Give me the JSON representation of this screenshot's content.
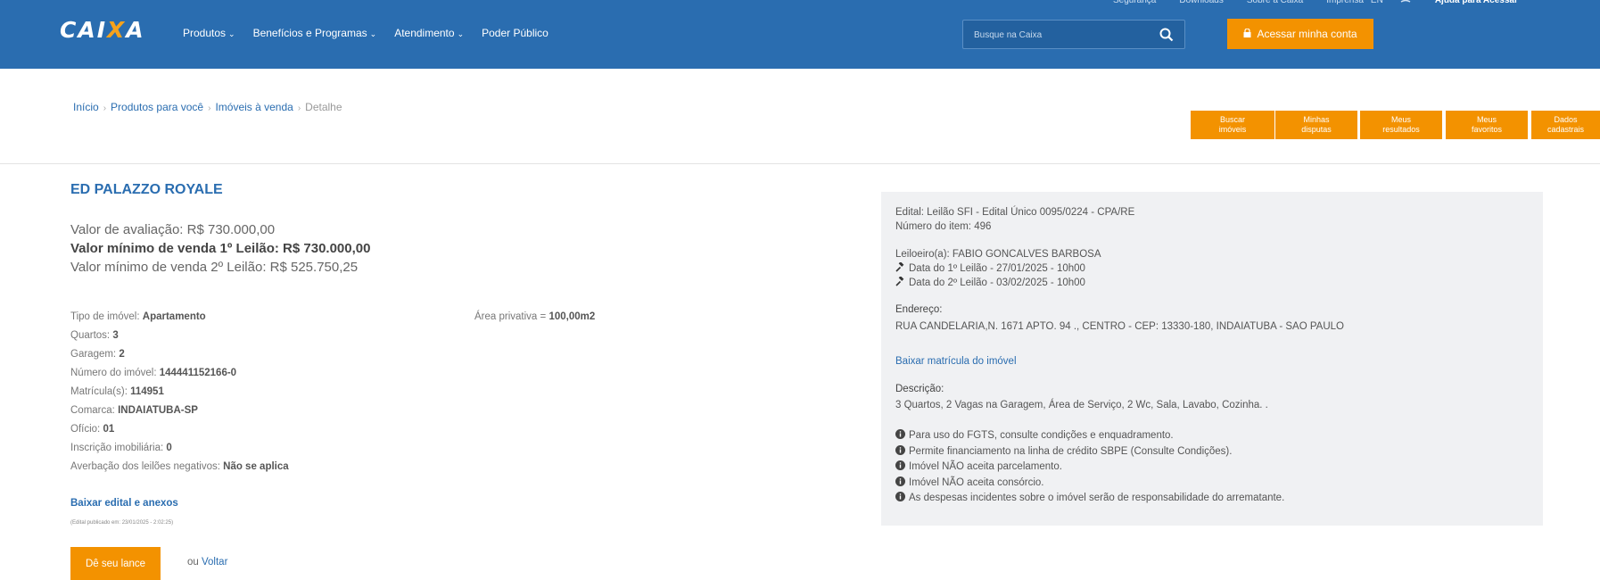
{
  "header": {
    "logo_text_a": "CAI",
    "logo_text_x": "X",
    "logo_text_b": "A",
    "nav": [
      "Produtos",
      "Benefícios e Programas",
      "Atendimento",
      "Poder Público"
    ],
    "utility": [
      "Segurança",
      "Downloads",
      "Sobre a Caixa",
      "Imprensa",
      "EN"
    ],
    "utility_help": "Ajuda para Acessar",
    "search_placeholder": "Busque na Caixa",
    "access_label": "Acessar minha conta",
    "colors": {
      "bar": "#2a6db0",
      "accent": "#f39200"
    }
  },
  "breadcrumb": {
    "home": "Início",
    "products": "Produtos para você",
    "properties": "Imóveis à venda",
    "current": "Detalhe"
  },
  "quick_buttons": [
    {
      "line1": "Buscar",
      "line2": "imóveis"
    },
    {
      "line1": "Minhas",
      "line2": "disputas"
    },
    {
      "line1": "Meus",
      "line2": "resultados"
    },
    {
      "line1": "Meus",
      "line2": "favoritos"
    },
    {
      "line1": "Dados",
      "line2": "cadastrais"
    }
  ],
  "property": {
    "title": "ED PALAZZO ROYALE",
    "valuation": "Valor de avaliação: R$ 730.000,00",
    "min_price_1": "Valor mínimo de venda 1º Leilão: R$ 730.000,00",
    "min_price_2": "Valor mínimo de venda 2º Leilão: R$ 525.750,25",
    "details": [
      {
        "label": "Tipo de imóvel:",
        "value": "Apartamento"
      },
      {
        "label": "Quartos:",
        "value": "3"
      },
      {
        "label": "Garagem:",
        "value": "2"
      },
      {
        "label": "Número do imóvel:",
        "value": "144441152166-0"
      },
      {
        "label": "Matrícula(s):",
        "value": "114951"
      },
      {
        "label": "Comarca:",
        "value": "INDAIATUBA-SP"
      },
      {
        "label": "Ofício:",
        "value": "01"
      },
      {
        "label": "Inscrição imobiliária:",
        "value": "0"
      },
      {
        "label": "Averbação dos leilões negativos:",
        "value": "Não se aplica"
      }
    ],
    "area_label": "Área privativa =",
    "area_value": "100,00m2",
    "edital_link": "Baixar edital e anexos",
    "edital_date": "(Edital publicado em: 23/01/2025 - 2:02:25)",
    "bid_button": "Dê seu lance",
    "back_prefix": "ou",
    "back_link": "Voltar"
  },
  "panel": {
    "edital": "Edital: Leilão SFI - Edital Único 0095/0224 - CPA/RE",
    "item_number": "Número do item: 496",
    "auctioneer": "Leiloeiro(a): FABIO GONCALVES BARBOSA",
    "date_1": "Data do 1º Leilão - 27/01/2025 - 10h00",
    "date_2": "Data do 2º Leilão - 03/02/2025 - 10h00",
    "address_label": "Endereço:",
    "address": "RUA CANDELARIA,N. 1671 APTO. 94 ., CENTRO - CEP: 13330-180, INDAIATUBA - SAO PAULO",
    "matricula_link": "Baixar matrícula do imóvel",
    "description_label": "Descrição:",
    "description": "3 Quartos, 2 Vagas na Garagem, Área de Serviço, 2 Wc, Sala, Lavabo, Cozinha. .",
    "notes": [
      "Para uso do FGTS, consulte condições e enquadramento.",
      "Permite financiamento na linha de crédito SBPE (Consulte Condições).",
      "Imóvel NÃO aceita parcelamento.",
      "Imóvel NÃO aceita consórcio.",
      "As despesas incidentes sobre o imóvel serão de responsabilidade do arrematante."
    ]
  }
}
